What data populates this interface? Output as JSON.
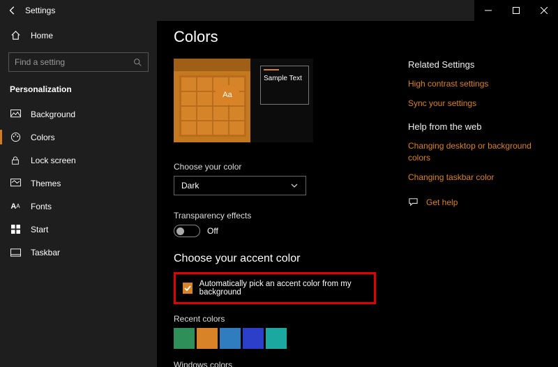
{
  "titlebar": {
    "title": "Settings"
  },
  "sidebar": {
    "home": "Home",
    "search_placeholder": "Find a setting",
    "section": "Personalization",
    "items": [
      {
        "label": "Background"
      },
      {
        "label": "Colors"
      },
      {
        "label": "Lock screen"
      },
      {
        "label": "Themes"
      },
      {
        "label": "Fonts"
      },
      {
        "label": "Start"
      },
      {
        "label": "Taskbar"
      }
    ]
  },
  "main": {
    "title": "Colors",
    "sample_text": "Sample Text",
    "aa": "Aa",
    "choose_color_label": "Choose your color",
    "choose_color_value": "Dark",
    "transparency_label": "Transparency effects",
    "transparency_state": "Off",
    "accent_heading": "Choose your accent color",
    "auto_accent_label": "Automatically pick an accent color from my background",
    "recent_colors_label": "Recent colors",
    "recent_colors": [
      "#2e8f59",
      "#d88327",
      "#2f7cbf",
      "#2c3fc9",
      "#1aa8a0"
    ],
    "windows_colors_label": "Windows colors"
  },
  "right": {
    "related_heading": "Related Settings",
    "links_related": [
      "High contrast settings",
      "Sync your settings"
    ],
    "help_heading": "Help from the web",
    "links_help": [
      "Changing desktop or background colors",
      "Changing taskbar color"
    ],
    "get_help": "Get help"
  }
}
